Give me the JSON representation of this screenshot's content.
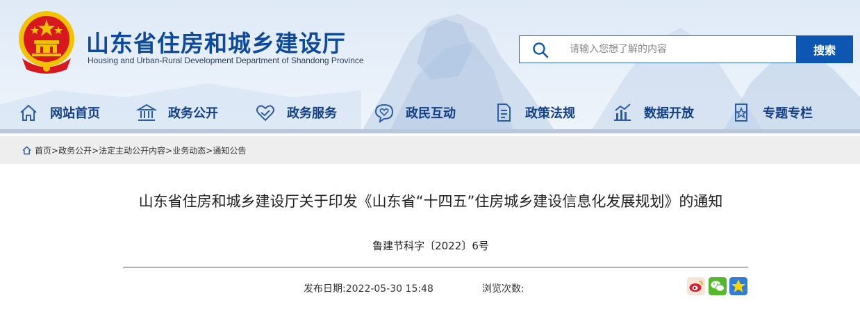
{
  "site": {
    "title": "山东省住房和城乡建设厅",
    "subtitle": "Housing and Urban-Rural Development Department of Shandong Province"
  },
  "search": {
    "placeholder": "请输入您想了解的内容",
    "button_label": "搜索"
  },
  "nav": {
    "items": [
      {
        "label": "网站首页",
        "icon": "home-icon"
      },
      {
        "label": "政务公开",
        "icon": "government-building-icon"
      },
      {
        "label": "政务服务",
        "icon": "heart-hands-icon"
      },
      {
        "label": "政民互动",
        "icon": "chat-heart-icon"
      },
      {
        "label": "政策法规",
        "icon": "document-icon"
      },
      {
        "label": "数据开放",
        "icon": "bar-chart-icon"
      },
      {
        "label": "专题专栏",
        "icon": "star-document-icon"
      }
    ]
  },
  "breadcrumb": {
    "items": [
      "首页",
      "政务公开",
      "法定主动公开内容",
      "业务动态",
      "通知公告"
    ],
    "separator": ">"
  },
  "article": {
    "title": "山东省住房和城乡建设厅关于印发《山东省“十四五”住房城乡建设信息化发展规划》的通知",
    "doc_number": "鲁建节科字〔2022〕6号",
    "publish_label": "发布日期:",
    "publish_date": "2022-05-30 15:48",
    "views_label": "浏览次数:"
  },
  "share": {
    "buttons": [
      "weibo-icon",
      "wechat-icon",
      "qzone-icon"
    ]
  },
  "colors": {
    "brand": "#0d4a9e",
    "nav_text": "#123f86",
    "search_button": "#0d57b3",
    "breadcrumb_bg": "#eeeeee"
  }
}
